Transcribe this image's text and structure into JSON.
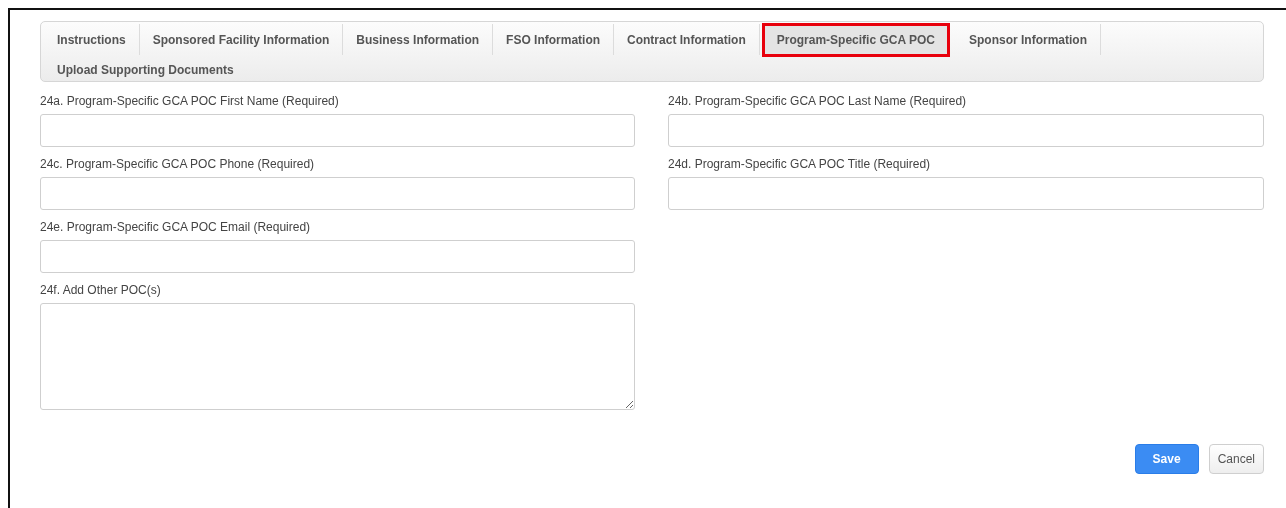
{
  "tabs": [
    {
      "label": "Instructions",
      "selected": false
    },
    {
      "label": "Sponsored Facility Information",
      "selected": false
    },
    {
      "label": "Business Information",
      "selected": false
    },
    {
      "label": "FSO Information",
      "selected": false
    },
    {
      "label": "Contract Information",
      "selected": false
    },
    {
      "label": "Program-Specific GCA POC",
      "selected": true
    },
    {
      "label": "Sponsor Information",
      "selected": false
    },
    {
      "label": "Upload Supporting Documents",
      "selected": false
    }
  ],
  "form_rows": [
    [
      {
        "kind": "text",
        "label": "24a. Program-Specific GCA POC First Name (Required)"
      },
      {
        "kind": "text",
        "label": "24b. Program-Specific GCA POC Last Name (Required)"
      }
    ],
    [
      {
        "kind": "text",
        "label": "24c. Program-Specific GCA POC Phone (Required)"
      },
      {
        "kind": "text",
        "label": "24d. Program-Specific GCA POC Title (Required)"
      }
    ],
    [
      {
        "kind": "text",
        "label": "24e. Program-Specific GCA POC Email (Required)"
      }
    ],
    [
      {
        "kind": "textarea",
        "label": "24f. Add Other POC(s)"
      }
    ]
  ],
  "buttons": [
    {
      "kind": "primary",
      "label": "Save"
    },
    {
      "kind": "secondary",
      "label": "Cancel"
    }
  ]
}
